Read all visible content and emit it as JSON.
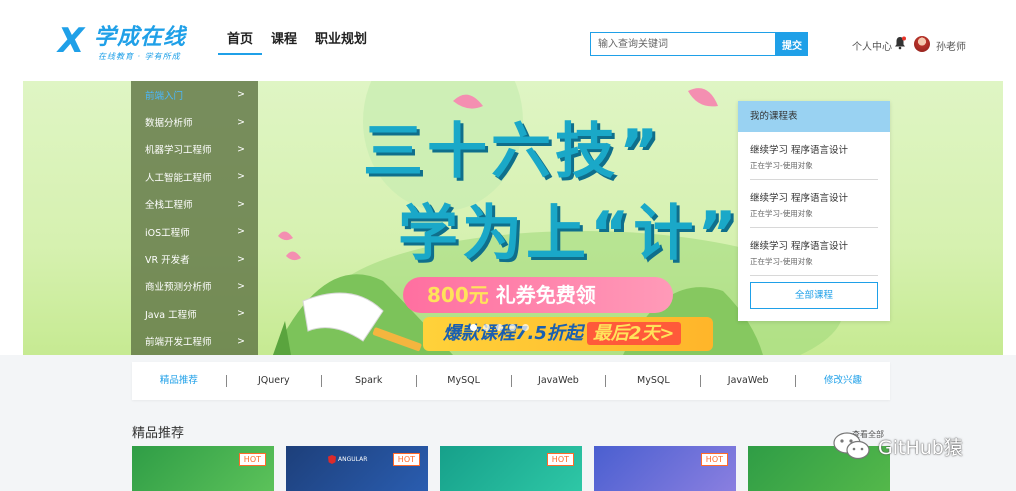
{
  "header": {
    "logo_text": "学成在线",
    "logo_slogan": "在线教育 · 学有所成",
    "nav": [
      {
        "label": "首页",
        "active": true
      },
      {
        "label": "课程",
        "active": false
      },
      {
        "label": "职业规划",
        "active": false
      }
    ],
    "search": {
      "placeholder": "输入查询关键词",
      "button_label": "提交"
    },
    "user_center_label": "个人中心",
    "teacher_name": "孙老师"
  },
  "category_menu": {
    "items": [
      {
        "label": "前端入门",
        "arrow": ">",
        "active": true
      },
      {
        "label": "数据分析师",
        "arrow": ">"
      },
      {
        "label": "机器学习工程师",
        "arrow": ">"
      },
      {
        "label": "人工智能工程师",
        "arrow": ">"
      },
      {
        "label": "全栈工程师",
        "arrow": ">"
      },
      {
        "label": "iOS工程师",
        "arrow": ">"
      },
      {
        "label": "VR 开发者",
        "arrow": ">"
      },
      {
        "label": "商业预测分析师",
        "arrow": ">"
      },
      {
        "label": "Java 工程师",
        "arrow": ">"
      },
      {
        "label": "前端开发工程师",
        "arrow": ">"
      }
    ]
  },
  "banner": {
    "headline_line1": "三十六技”",
    "headline_line2": "学为上“计”",
    "promo_amount": "800元",
    "promo_text": "礼券免费领",
    "promo2_text": "爆款课程7.5折起",
    "promo2_highlight": "最后2天>"
  },
  "my_courses": {
    "title": "我的课程表",
    "items": [
      {
        "name": "继续学习 程序语言设计",
        "sub": "正在学习-使用对象"
      },
      {
        "name": "继续学习 程序语言设计",
        "sub": "正在学习-使用对象"
      },
      {
        "name": "继续学习 程序语言设计",
        "sub": "正在学习-使用对象"
      }
    ],
    "all_button_label": "全部课程"
  },
  "tags": [
    {
      "label": "精品推荐",
      "highlight": true
    },
    {
      "label": "JQuery"
    },
    {
      "label": "Spark"
    },
    {
      "label": "MySQL"
    },
    {
      "label": "JavaWeb"
    },
    {
      "label": "MySQL"
    },
    {
      "label": "JavaWeb"
    },
    {
      "label": "修改兴趣",
      "highlight": true
    }
  ],
  "section": {
    "title": "精品推荐",
    "see_all": "查看全部"
  },
  "cards": [
    {
      "badge": "HOT",
      "bg": "#3aa84e"
    },
    {
      "badge": "HOT",
      "bg": "#1d3f7a",
      "logo_text": "ANGULAR"
    },
    {
      "badge": "HOT",
      "bg": "#1eae96"
    },
    {
      "badge": "HOT",
      "bg": "#5b6cd6"
    },
    {
      "badge": "",
      "bg": "#2f9d46"
    }
  ],
  "watermark": {
    "text": "GitHub猿"
  },
  "colors": {
    "accent": "#1fa0e8",
    "hot": "#ff6a2a",
    "promo_pink": "#ff6fa0",
    "promo_yellow": "#ffd23a"
  }
}
